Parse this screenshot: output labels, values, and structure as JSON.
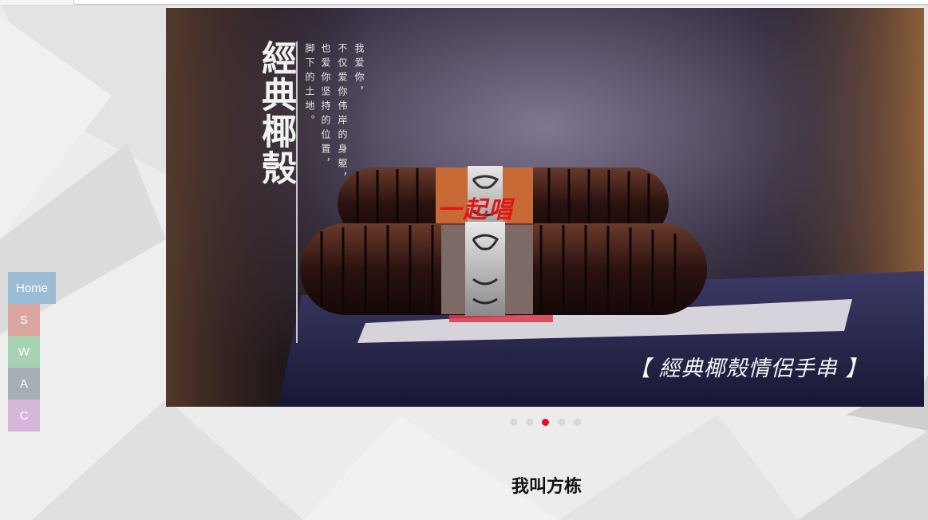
{
  "nav": {
    "items": [
      {
        "label": "Home",
        "color": "#9cbdd6"
      },
      {
        "label": "S",
        "color": "#dba6a1"
      },
      {
        "label": "W",
        "color": "#a6d1b2"
      },
      {
        "label": "A",
        "color": "#a8aeb6"
      },
      {
        "label": "C",
        "color": "#d8b5db"
      }
    ]
  },
  "banner": {
    "vertical_title": "經典椰殼",
    "poem": [
      "我爱你，",
      "不仅爱你伟岸的身躯，",
      "也爱你坚持的位置，",
      "脚下的土地。"
    ],
    "bead_label": "一起唱",
    "caption": "【 經典椰殼情侶手串 】"
  },
  "slider": {
    "slide_count": 5,
    "active_index": 2,
    "active_color": "#e01020"
  },
  "main": {
    "heading": "我叫方栋"
  }
}
